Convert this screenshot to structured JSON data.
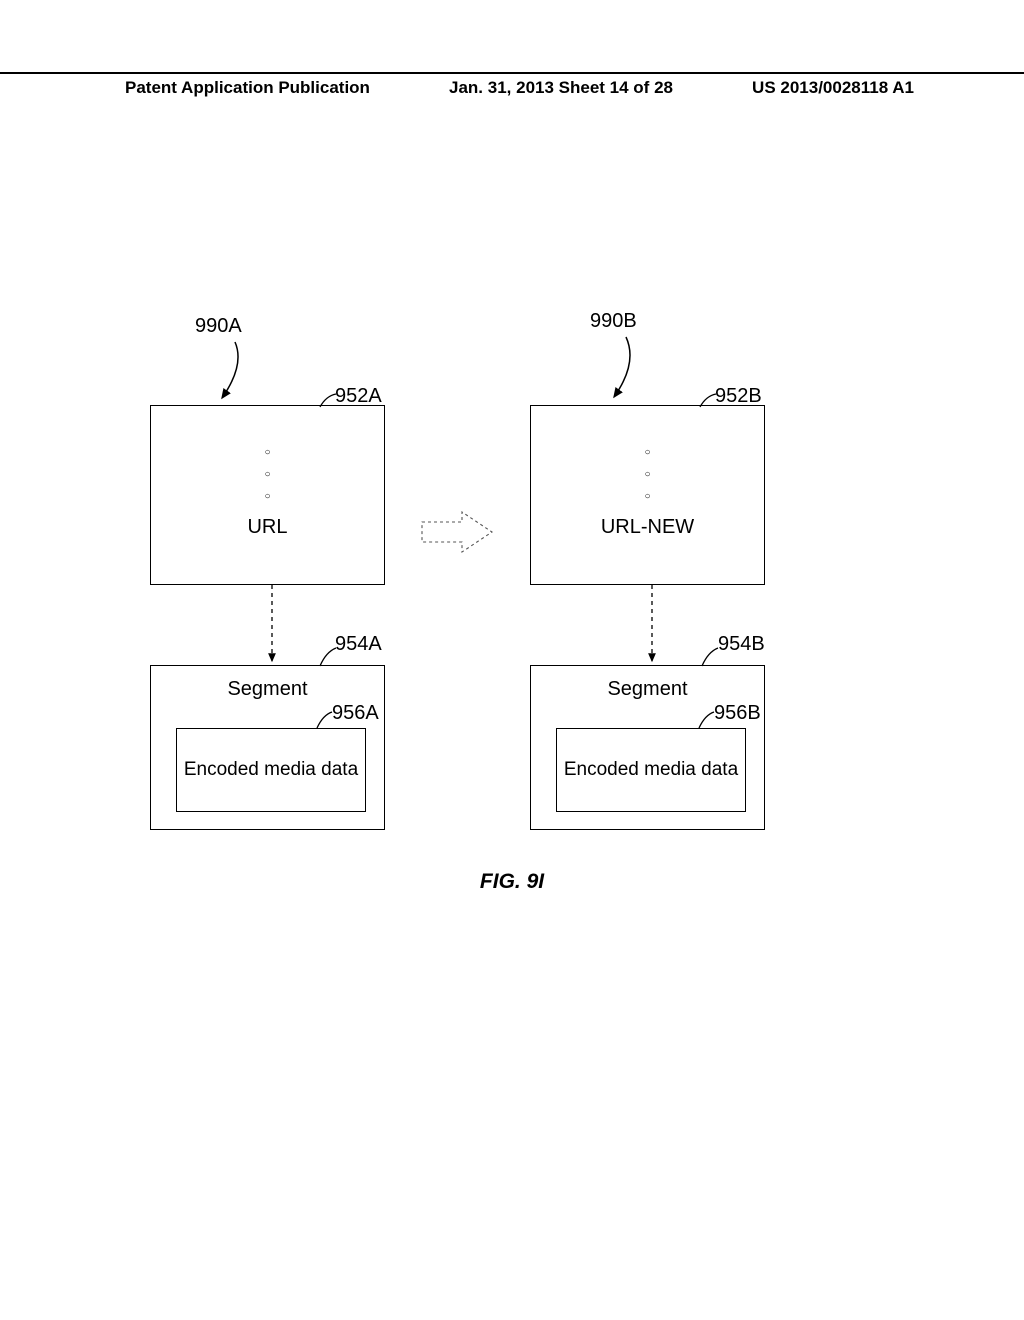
{
  "header": {
    "left": "Patent Application Publication",
    "center": "Jan. 31, 2013  Sheet 14 of 28",
    "right": "US 2013/0028118 A1"
  },
  "labels": {
    "group_a": "990A",
    "group_b": "990B",
    "url_box_a": "952A",
    "url_box_b": "952B",
    "seg_box_a": "954A",
    "seg_box_b": "954B",
    "inner_a": "956A",
    "inner_b": "956B",
    "url_a_text": "URL",
    "url_b_text": "URL-NEW",
    "segment": "Segment",
    "encoded": "Encoded media data"
  },
  "figure_caption": "FIG. 9I"
}
